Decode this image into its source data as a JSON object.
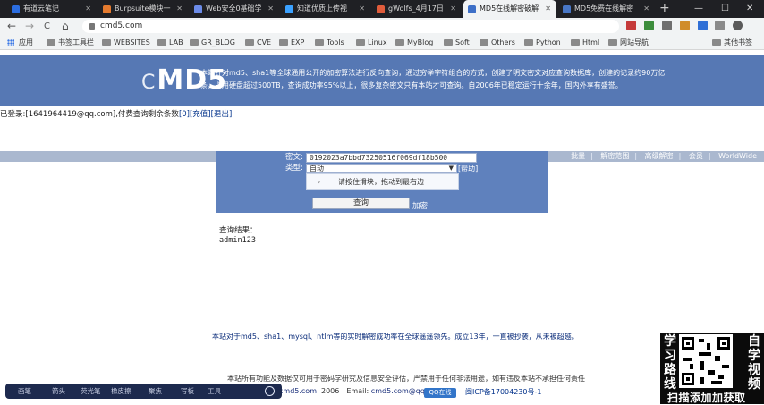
{
  "browser": {
    "tabs": [
      {
        "label": "有道云笔记",
        "color": "#2b6de0"
      },
      {
        "label": "Burpsuite模块一",
        "color": "#e47a2e"
      },
      {
        "label": "Web安全0基础学",
        "color": "#6b8be8"
      },
      {
        "label": "知道优质上传视",
        "color": "#3aa1ff"
      },
      {
        "label": "gWolfs_4月17日",
        "color": "#e05c3b"
      },
      {
        "label": "MD5在线解密破解",
        "color": "#3d6fc7"
      },
      {
        "label": "MD5免费在线解密",
        "color": "#4877c6"
      }
    ],
    "active_tab_index": 5,
    "new_tab": "+",
    "window_controls": [
      "—",
      "☐",
      "✕"
    ],
    "nav": {
      "back": "←",
      "forward": "→",
      "reload": "C",
      "home": "⌂"
    },
    "url": "cmd5.com",
    "bookmarks": [
      "应用",
      "书签工具栏",
      "WEBSITES",
      "LAB",
      "GR_BLOG",
      "CVE",
      "EXP",
      "Tools",
      "Linux",
      "MyBlog",
      "Soft",
      "Others",
      "Python",
      "Html",
      "网站导航",
      "其他书签"
    ]
  },
  "header": {
    "logo_prefix": "C",
    "logo_text": "MD5",
    "intro": "本站针对md5、sha1等全球通用公开的加密算法进行反向查询，通过穷举字符组合的方式，创建了明文密文对应查询数据库，创建的记录约90万亿条，占用硬盘超过500TB，查询成功率95%以上，很多复杂密文只有本站才可查询。自2006年已稳定运行十余年，国内外享有盛誉。",
    "submenu": [
      "批量",
      "解密范围",
      "高级解密",
      "会员",
      "WorldWide"
    ]
  },
  "login_line": {
    "prefix": "已登录:",
    "email": "[1641964419@qq.com]",
    "middle": ",付费查询剩余条数",
    "count": "[0]",
    "recharge": "[充值]",
    "logout": "[退出]"
  },
  "form": {
    "cipher_label": "密文:",
    "cipher_value": "0192023a7bbd73250516f069df18b500",
    "type_label": "类型:",
    "type_value": "自动",
    "type_option_link": "[帮助]",
    "help_text": "请按住滑块，拖动到最右边",
    "submit_label": "查询",
    "add_link": "加密"
  },
  "result": {
    "label": "查询结果：",
    "value": "admin123"
  },
  "footer": {
    "about": "本站对于md5、sha1、mysql、ntlm等的实时解密成功率在全球遥遥领先。成立13年，一直被抄袭，从未被超越。",
    "disclaimer": "本站所有功能及数据仅可用于密码学研究及信息安全评估，严禁用于任何非法用途，如有违反本站不承担任何责任",
    "site": "cmd5.com",
    "year": "2006",
    "email_label": "Email:",
    "email": "cmd5.com@qq.com",
    "qq_badge": "QQ在线",
    "icp": "闽ICP备17004230号-1"
  },
  "taskbar": [
    "画笔",
    "箭头",
    "荧光笔",
    "橡皮擦",
    "聚焦",
    "写板",
    "工具"
  ],
  "promo": {
    "left": [
      "学",
      "习",
      "路",
      "线"
    ],
    "right": [
      "自",
      "学",
      "视",
      "频"
    ],
    "bottom": "扫描添加加获取"
  }
}
